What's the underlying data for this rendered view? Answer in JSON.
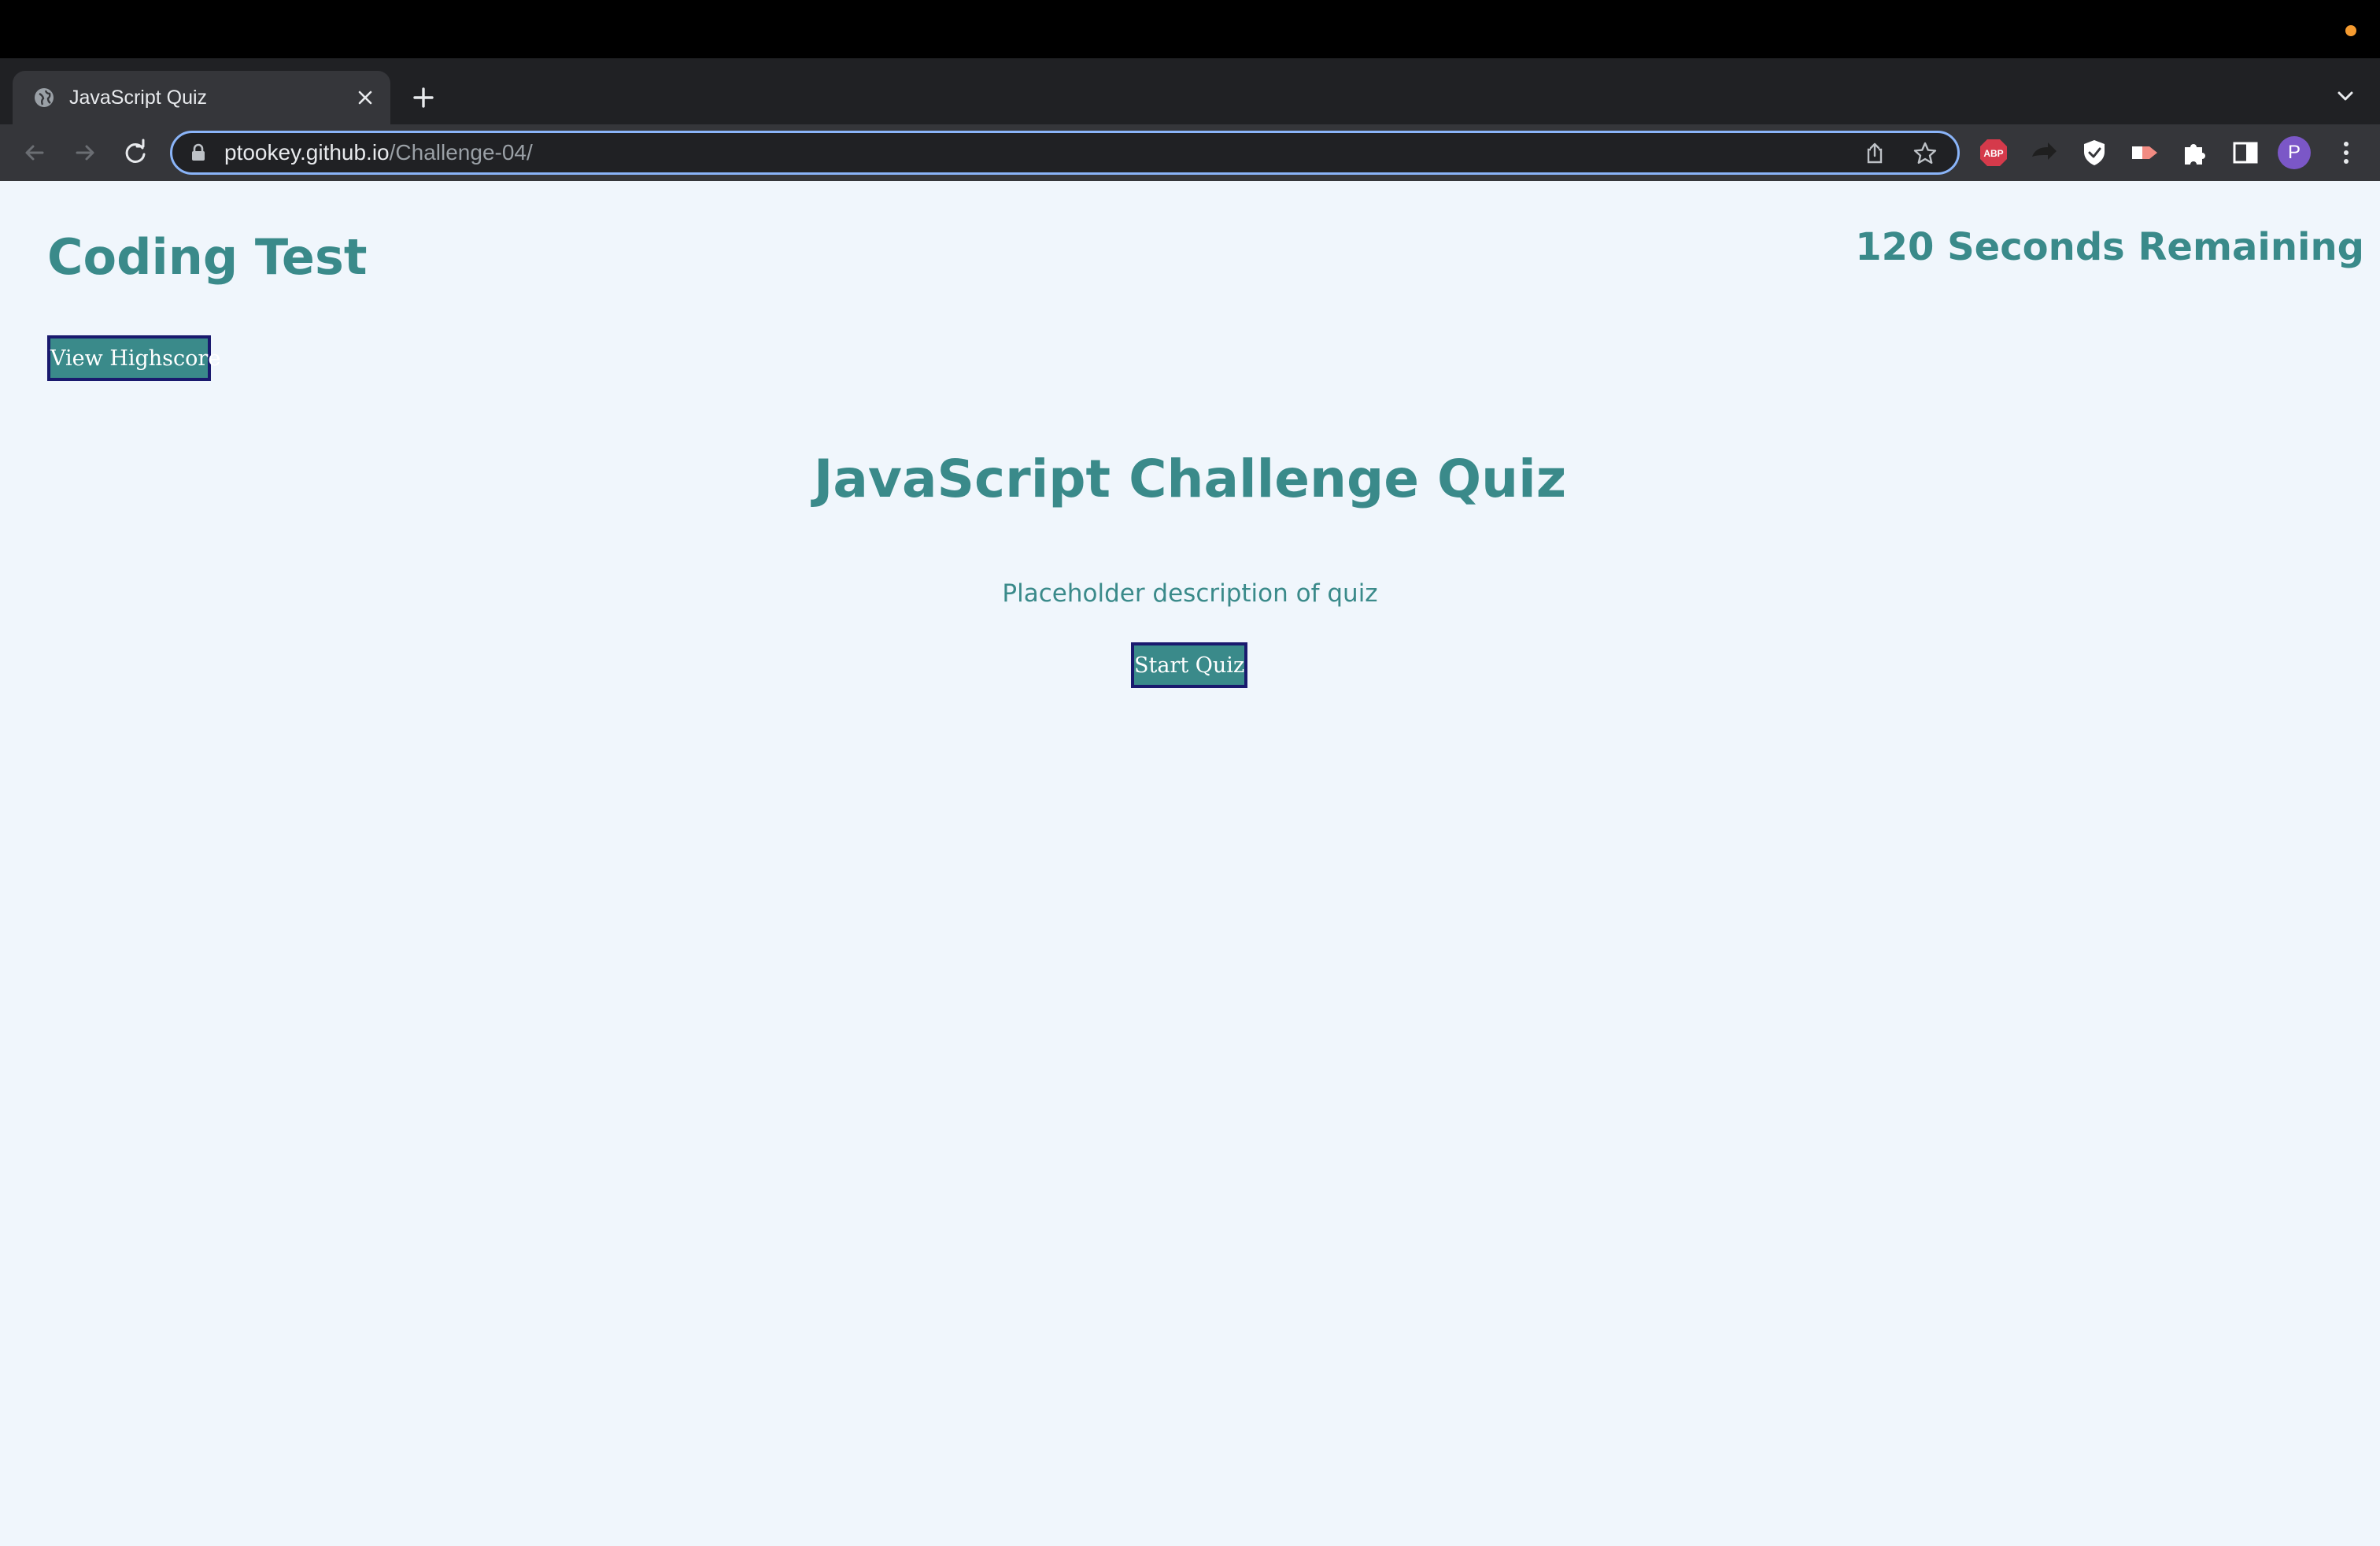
{
  "browser": {
    "tab": {
      "title": "JavaScript Quiz",
      "favicon_icon": "globe-icon"
    },
    "address_bar": {
      "host": "ptookey.github.io",
      "path": "/Challenge-04/"
    },
    "extensions": [
      "adblock-plus-icon",
      "forward-arrow-icon",
      "shield-icon",
      "tag-icon",
      "puzzle-icon",
      "side-panel-icon"
    ],
    "profile_initial": "P"
  },
  "page": {
    "site_title": "Coding Test",
    "timer_text": "120 Seconds Remaining",
    "view_highscore_label": "View Highscore",
    "quiz_title": "JavaScript Challenge Quiz",
    "quiz_description": "Placeholder description of quiz",
    "start_label": "Start Quiz"
  },
  "colors": {
    "accent": "#3a8a8a",
    "page_background": "#f0f6fc",
    "button_border": "#1a1a6e"
  }
}
